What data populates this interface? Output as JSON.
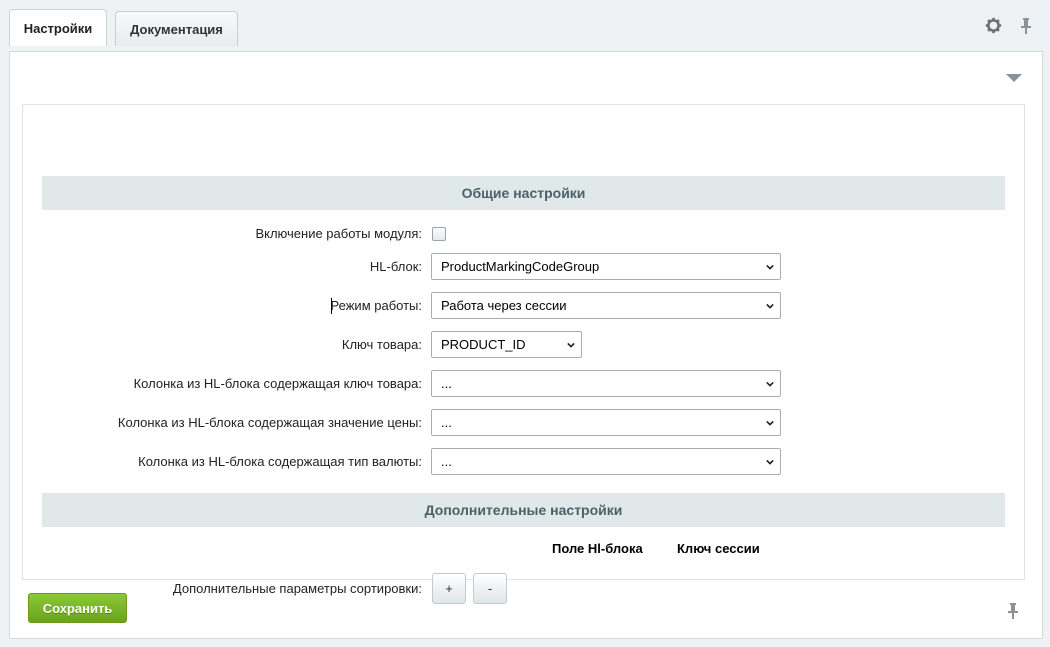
{
  "tabs": [
    {
      "label": "Настройки",
      "active": true
    },
    {
      "label": "Документация",
      "active": false
    }
  ],
  "header_icons": {
    "gear": "gear-icon",
    "pin": "pin-icon"
  },
  "sections": {
    "general": "Общие настройки",
    "additional": "Дополнительные настройки"
  },
  "fields": {
    "module_enable": {
      "label": "Включение работы модуля:",
      "checked": false
    },
    "hl_block": {
      "label": "HL-блок:",
      "value": "ProductMarkingCodeGroup"
    },
    "work_mode": {
      "label": "Режим работы:",
      "value": "Работа через сессии"
    },
    "product_key": {
      "label": "Ключ товара:",
      "value": "PRODUCT_ID"
    },
    "key_column": {
      "label": "Колонка из HL-блока содержащая ключ товара:",
      "value": "..."
    },
    "price_column": {
      "label": "Колонка из HL-блока содержащая значение цены:",
      "value": "..."
    },
    "currency_column": {
      "label": "Колонка из HL-блока содержащая тип валюты:",
      "value": "..."
    }
  },
  "sorting": {
    "col_hl_field": "Поле Hl-блока",
    "col_session_key": "Ключ сессии",
    "label": "Дополнительные параметры сортировки:",
    "add_label": "+",
    "remove_label": "-"
  },
  "footer": {
    "save_label": "Сохранить"
  },
  "colors": {
    "save": "#7ab82a",
    "section_bg": "#e0e8ea",
    "section_text": "#4b6267"
  }
}
